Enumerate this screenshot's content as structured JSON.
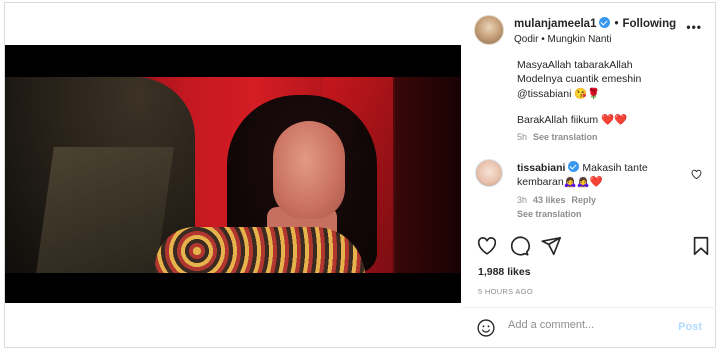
{
  "post": {
    "username": "mulanjameela1",
    "follow_label": "Following",
    "subline": "Qodir • Mungkin Nanti",
    "more_label": "•••"
  },
  "caption": {
    "line1": "MasyaAllah tabarakAllah",
    "line2": "Modelnya cuantik emeshin",
    "line3": "@tissabiani 😘🌹",
    "line4": "BarakAllah fiikum ❤️❤️",
    "time": "5h",
    "see_translation": "See translation"
  },
  "reply": {
    "username": "tissabiani",
    "text_line1": "Makasih tante",
    "text_line2": "kembaran🙇‍♀️🙇‍♀️❤️",
    "time": "3h",
    "likes": "43 likes",
    "reply_label": "Reply",
    "see_translation": "See translation"
  },
  "stats": {
    "likes": "1,988 likes",
    "ago": "5 HOURS AGO"
  },
  "composer": {
    "placeholder": "Add a comment...",
    "post_label": "Post"
  },
  "colors": {
    "accent_blue": "#3897f0",
    "post_disabled": "#b3dbff",
    "heart_red": "#ed4956",
    "muted_text": "#8e8e8e"
  },
  "icons": [
    "user-tag-icon",
    "mute-icon",
    "verified-icon",
    "more-options-icon",
    "like-icon",
    "comment-icon",
    "share-icon",
    "save-icon",
    "emoji-icon",
    "comment-like-icon"
  ]
}
